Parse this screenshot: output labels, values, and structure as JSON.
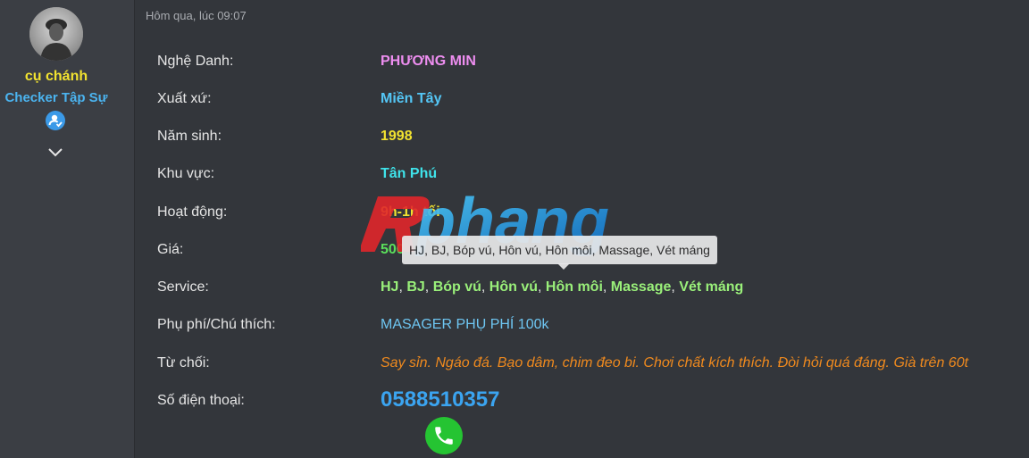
{
  "sidebar": {
    "username": "cụ chánh",
    "user_title": "Checker Tập Sự",
    "badge_icon": "verified-user-icon",
    "expand_icon": "chevron-down-icon"
  },
  "post": {
    "timestamp": "Hôm qua, lúc 09:07",
    "fields": [
      {
        "label": "Nghệ Danh:",
        "value": "PHƯƠNG MIN",
        "color": "#ee8ef0"
      },
      {
        "label": "Xuất xứ:",
        "value": "Miền Tây",
        "color": "#54c6f5"
      },
      {
        "label": "Năm sinh:",
        "value": "1998",
        "color": "#f2e330"
      },
      {
        "label": "Khu vực:",
        "value": "Tân Phú",
        "color": "#3fe3ea"
      },
      {
        "label": "Hoạt động:",
        "value": "9h-1h tối",
        "color": "#f2e330"
      },
      {
        "label": "Giá:",
        "value": "500",
        "color": "#5be05b"
      },
      {
        "label": "Service:",
        "value": "HJ, BJ, Bóp vú, Hôn vú, Hôn môi, Massage, Vét máng",
        "color": "#9af07a"
      },
      {
        "label": "Phụ phí/Chú thích:",
        "value": "MASAGER PHỤ PHÍ 100k",
        "color": "#6ec6f2"
      },
      {
        "label": "Từ chối:",
        "value": "Say sỉn. Ngáo đá. Bạo dâm, chim đeo bi. Chơi chất kích thích. Đòi hỏi quá đáng. Già trên 60t",
        "color": "#f08a1e"
      },
      {
        "label": "Số điện thoại:",
        "value": "0588510357",
        "color": "#3ba4f0"
      }
    ],
    "services": [
      "HJ",
      "BJ",
      "Bóp vú",
      "Hôn vú",
      "Hôn môi",
      "Massage",
      "Vét máng"
    ],
    "tooltip": "HJ, BJ, Bóp vú, Hôn vú, Hôn môi, Massage, Vét máng",
    "watermark": "Rphang",
    "call_icon": "phone-icon"
  }
}
